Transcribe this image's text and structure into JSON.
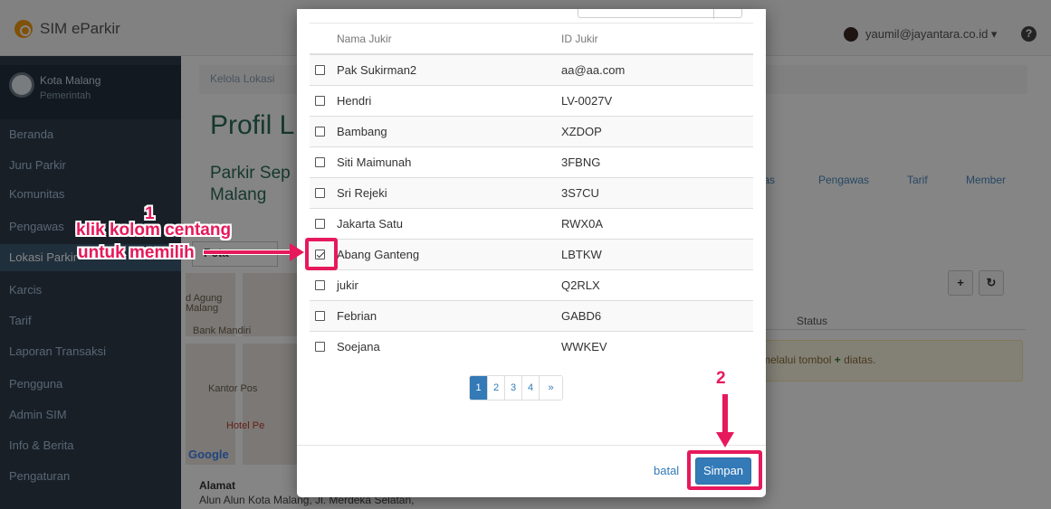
{
  "app": {
    "title": "SIM eParkir",
    "user": "yaumil@jayantara.co.id ▾",
    "help": "?"
  },
  "org": {
    "name": "Kota Malang",
    "subtitle": "Pemerintah"
  },
  "sidebar": {
    "items": [
      {
        "label": "Beranda"
      },
      {
        "label": "Juru Parkir"
      },
      {
        "label": "Komunitas"
      },
      {
        "label": "Pengawas"
      },
      {
        "label": "Lokasi Parkir"
      },
      {
        "label": "Karcis"
      },
      {
        "label": "Tarif"
      },
      {
        "label": "Laporan Transaksi"
      },
      {
        "label": "Pengguna"
      },
      {
        "label": "Admin SIM"
      },
      {
        "label": "Info & Berita"
      },
      {
        "label": "Pengaturan"
      }
    ]
  },
  "page": {
    "breadcrumb": "Kelola Lokasi",
    "title": "Profil L",
    "subtitle": "Parkir Sep Malang",
    "tabs": [
      "tas",
      "Pengawas",
      "Tarif",
      "Member"
    ],
    "map_tab": "Peta",
    "status_header": "Status",
    "alert": "melalui tombol",
    "alert_plus": "+",
    "alert_suffix": "diatas.",
    "alamat_label": "Alamat",
    "alamat_value": "Alun Alun Kota Malang, Jl. Merdeka Selatan,",
    "map": {
      "labels": [
        "d Agung",
        "Malang",
        "Bank Mandiri",
        "Kantor Pos",
        "Hotel Pe"
      ],
      "google": "Google"
    },
    "add_btn": "+",
    "refresh_btn": "↻"
  },
  "modal": {
    "columns": [
      "Nama Jukir",
      "ID Jukir"
    ],
    "rows": [
      {
        "name": "Pak Sukirman2",
        "id": "aa@aa.com",
        "checked": false
      },
      {
        "name": "Hendri",
        "id": "LV-0027V",
        "checked": false
      },
      {
        "name": "Bambang",
        "id": "XZDOP",
        "checked": false
      },
      {
        "name": "Siti Maimunah",
        "id": "3FBNG",
        "checked": false
      },
      {
        "name": "Sri Rejeki",
        "id": "3S7CU",
        "checked": false
      },
      {
        "name": "Jakarta Satu",
        "id": "RWX0A",
        "checked": false
      },
      {
        "name": "Abang Ganteng",
        "id": "LBTKW",
        "checked": true
      },
      {
        "name": "jukir",
        "id": "Q2RLX",
        "checked": false
      },
      {
        "name": "Febrian",
        "id": "GABD6",
        "checked": false
      },
      {
        "name": "Soejana",
        "id": "WWKEV",
        "checked": false
      }
    ],
    "pagination": [
      "1",
      "2",
      "3",
      "4",
      "»"
    ],
    "cancel_label": "batal",
    "save_label": "Simpan"
  },
  "annotations": {
    "step1_number": "1",
    "step1_line1": "klik kolom centang",
    "step1_line2": "untuk memilih",
    "step2_number": "2",
    "color": "#e6195c"
  }
}
